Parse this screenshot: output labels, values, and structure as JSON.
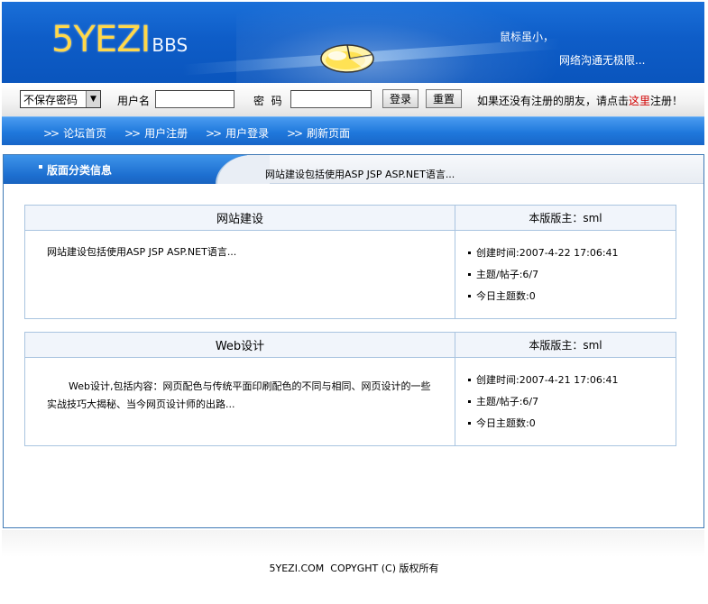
{
  "header": {
    "logo_main": "5YEZI",
    "logo_sub": "BBS",
    "slogan_line1": "鼠标虽小，",
    "slogan_line2": "网络沟通无极限..."
  },
  "login": {
    "cookie_select_value": "不保存密码",
    "username_label": "用户名",
    "password_label": "密  码",
    "login_button": "登录",
    "reset_button": "重置",
    "register_hint_before": "如果还没有注册的朋友，请点击",
    "register_hint_link": "这里",
    "register_hint_after": "注册！"
  },
  "nav": {
    "items": [
      {
        "arrow": ">>",
        "label": "论坛首页"
      },
      {
        "arrow": ">>",
        "label": "用户注册"
      },
      {
        "arrow": ">>",
        "label": "用户登录"
      },
      {
        "arrow": ">>",
        "label": "刷新页面"
      }
    ]
  },
  "section": {
    "title": "版面分类信息",
    "description": "网站建设包括使用ASP JSP ASP.NET语言..."
  },
  "boards": [
    {
      "name": "网站建设",
      "moderator": "本版版主：sml",
      "description": "网站建设包括使用ASP JSP ASP.NET语言...",
      "created": "创建时间:2007-4-22 17:06:41",
      "topics_posts": "主题/帖子:6/7",
      "today_topics": "今日主题数:0"
    },
    {
      "name": "Web设计",
      "moderator": "本版版主：sml",
      "description": "Web设计,包括内容：网页配色与传统平面印刷配色的不同与相同、网页设计的一些实战技巧大揭秘、当今网页设计师的出路...",
      "created": "创建时间:2007-4-21 17:06:41",
      "topics_posts": "主题/帖子:6/7",
      "today_topics": "今日主题数:0"
    }
  ],
  "footer": {
    "copyright": "5YEZI.COM  COPYGHT (C) 版权所有"
  },
  "colors": {
    "header_blue": "#0e5dc8",
    "nav_blue": "#1f78dc",
    "logo_yellow": "#ffd84a",
    "link_red": "#d10000",
    "board_border": "#a9c4e0"
  }
}
